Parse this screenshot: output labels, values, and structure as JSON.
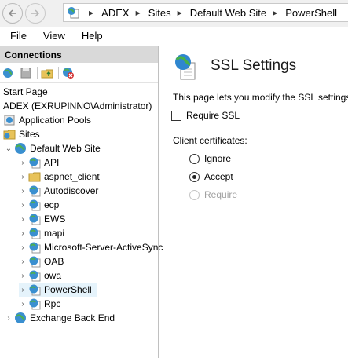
{
  "address_bar": {
    "breadcrumbs": [
      "ADEX",
      "Sites",
      "Default Web Site",
      "PowerShell"
    ]
  },
  "menu": {
    "items": [
      "File",
      "View",
      "Help"
    ]
  },
  "connections": {
    "title": "Connections",
    "tree": {
      "start_page": "Start Page",
      "server": "ADEX (EXRUPINNO\\Administrator)",
      "app_pools": "Application Pools",
      "sites": "Sites",
      "default_web_site": "Default Web Site",
      "children": [
        "API",
        "aspnet_client",
        "Autodiscover",
        "ecp",
        "EWS",
        "mapi",
        "Microsoft-Server-ActiveSync",
        "OAB",
        "owa",
        "PowerShell",
        "Rpc"
      ],
      "exchange_back_end": "Exchange Back End"
    }
  },
  "content": {
    "title": "SSL Settings",
    "description": "This page lets you modify the SSL settings",
    "require_ssl_label": "Require SSL",
    "require_ssl_checked": false,
    "client_certs_label": "Client certificates:",
    "options": [
      "Ignore",
      "Accept",
      "Require"
    ],
    "selected_option": "Accept"
  }
}
